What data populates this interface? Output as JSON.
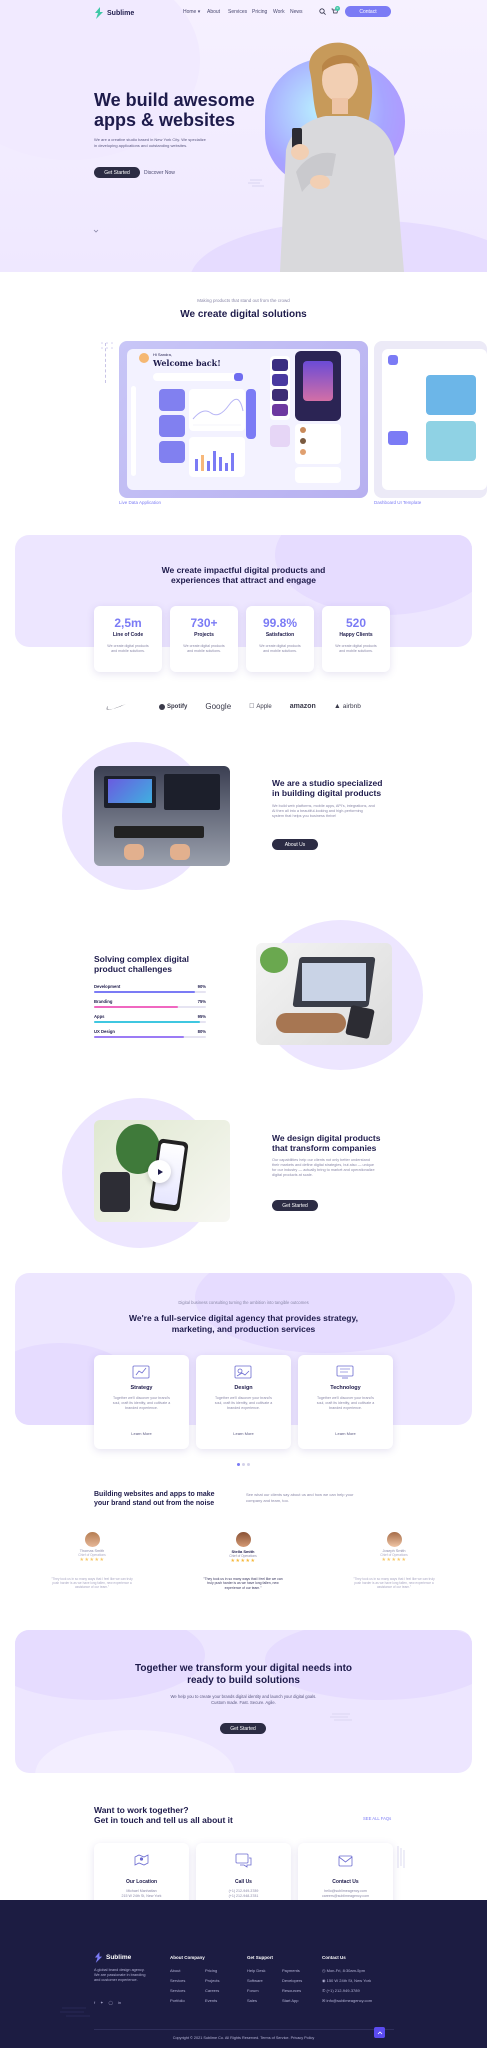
{
  "nav": {
    "brand": "Sublime",
    "links": [
      "Home ▾",
      "About",
      "Services",
      "Pricing",
      "Work",
      "News"
    ],
    "cart_count": "0",
    "contact_button": "Contact"
  },
  "hero": {
    "title_line1": "We build awesome",
    "title_line2": "apps & websites",
    "description_line1": "We are a creative studio based in New York City. We specialize",
    "description_line2": "in developing applications and outstanding websites.",
    "cta_primary": "Get Started",
    "cta_secondary": "Discover Now"
  },
  "showcase": {
    "overline": "Making products that stand out from the crowd",
    "title": "We create digital solutions",
    "mockup_greeting": "Hi Sandra,",
    "mockup_title": "Welcome back!",
    "captions": [
      "Live Data Application",
      "Dashboard UI Template"
    ]
  },
  "stats": {
    "title_line1": "We create impactful digital products and",
    "title_line2": "experiences that attract and engage",
    "items": [
      {
        "value": "2,5m",
        "label": "Line of Code",
        "text1": "We create digital products",
        "text2": "and mobile solutions."
      },
      {
        "value": "730+",
        "label": "Projects",
        "text1": "We create digital products",
        "text2": "and mobile solutions."
      },
      {
        "value": "99.8%",
        "label": "Satisfaction",
        "text1": "We create digital products",
        "text2": "and mobile solutions."
      },
      {
        "value": "520",
        "label": "Happy Clients",
        "text1": "We create digital products",
        "text2": "and mobile solutions."
      }
    ]
  },
  "logos": [
    "nike",
    "Spotify",
    "Google",
    "Apple",
    "amazon",
    "airbnb"
  ],
  "studio": {
    "title_line1": "We are a studio specialized",
    "title_line2": "in building digital products",
    "text": [
      "We build web platforms, mobile apps, API's, integrations, and",
      "Ai then all into a beautiful-looking and high-performing",
      "system that helps you business thrive!"
    ],
    "button": "About Us"
  },
  "skills": {
    "title_line1": "Solving complex digital",
    "title_line2": "product challenges",
    "items": [
      {
        "label": "Development",
        "value": "90%",
        "fraction": 0.9
      },
      {
        "label": "Branding",
        "value": "75%",
        "fraction": 0.75
      },
      {
        "label": "Apps",
        "value": "95%",
        "fraction": 0.95
      },
      {
        "label": "UX Design",
        "value": "80%",
        "fraction": 0.8
      }
    ]
  },
  "transform": {
    "title_line1": "We design digital products",
    "title_line2": "that transform companies",
    "text": [
      "Our capabilities help our clients not only better understand",
      "their markets and define digital strategies, but also — unique",
      "for our industry — actually bring to market and operationalize",
      "digital products at scale."
    ],
    "button": "Get Started"
  },
  "services": {
    "overline": "Digital business consulting turning the ambition into tangible outcomes",
    "title_line1": "We're a full-service digital agency that provides strategy,",
    "title_line2": "marketing, and production services",
    "items": [
      {
        "title": "Strategy",
        "text": [
          "Together we'll discover your brand's",
          "soul, craft its identity, and cultivate a",
          "branded experience."
        ],
        "link": "Learn More"
      },
      {
        "title": "Design",
        "text": [
          "Together we'll discover your brand's",
          "soul, craft its identity, and cultivate a",
          "branded experience."
        ],
        "link": "Learn More"
      },
      {
        "title": "Technology",
        "text": [
          "Together we'll discover your brand's",
          "soul, craft its identity, and cultivate a",
          "branded experience."
        ],
        "link": "Learn More"
      }
    ]
  },
  "testimonials": {
    "title_line1": "Building websites  and apps to make",
    "title_line2": "your brand stand out from the noise",
    "intro_line1": "See what our clients say about us and how we can help your",
    "intro_line2": "company and team, too.",
    "items": [
      {
        "name": "Thomas Smith",
        "role": "Chief of Operations",
        "stars": 5,
        "quote": [
          "\"They took us in so many ways that I feel like we can truly",
          "push harder is as we have long fallen, new experience a",
          "assistance of our team.\""
        ]
      },
      {
        "name": "Stella Smith",
        "role": "Chief of Operations",
        "stars": 5,
        "quote": [
          "\"They took us in so many ways that I feel like we can",
          "truly push harder is as we have long fallen, new",
          "experience of our team.\""
        ]
      },
      {
        "name": "Joseph Smith",
        "role": "Chief of Operations",
        "stars": 5,
        "quote": [
          "\"They took us in so many ways that I feel like we can truly",
          "push harder is as we have long fallen, new experience a",
          "assistance of our team.\""
        ]
      }
    ]
  },
  "cta": {
    "title_line1": "Together we transform your digital needs into",
    "title_line2": "ready to build solutions",
    "text_line1": "We help you to create your brands digital identity and launch your digital goals.",
    "text_line2": "Custom made. Fast. Secure. Agile.",
    "button": "Get Started"
  },
  "contact": {
    "title_line1": "Want to work together?",
    "title_line2": "Get in touch and tell us all about it",
    "link": "SEE ALL FAQs",
    "cards": [
      {
        "title": "Our Location",
        "lines": [
          "Michael Manhattan",
          "215 W 24th St, New York"
        ]
      },
      {
        "title": "Call Us",
        "lines": [
          "(+1) 212-949-3789",
          "(+1) 212-948-3781"
        ]
      },
      {
        "title": "Contact Us",
        "lines": [
          "hello@sublimeagency.com",
          "careers@sublimeagency.com"
        ]
      }
    ]
  },
  "footer": {
    "brand": "Sublime",
    "about_text": [
      "A global brand design agency.",
      "We are passionate in branding",
      "and customer experience."
    ],
    "columns": [
      {
        "title": "About Company",
        "links": [
          "About",
          "Services",
          "Services",
          "Portfolio"
        ]
      },
      {
        "title": "",
        "links": [
          "Pricing",
          "Projects",
          "Careers",
          "Events"
        ]
      },
      {
        "title": "Get Support",
        "links": [
          "Help Desk",
          "Software",
          "Forum",
          "Sales"
        ]
      },
      {
        "title": "",
        "links": [
          "Payments",
          "Developers",
          "Resources",
          "Start App"
        ]
      },
      {
        "title": "Contact Us",
        "links": [
          "Mon-Fri, 8:30am-5pm",
          "150 W 24th St, New York",
          "(+1) 212-949-3789",
          "info@sublimeagency.com"
        ]
      }
    ],
    "copyright": "Copyright © 2021 Sublime Co. All Rights Reserved. Terms of Service. Privacy Policy"
  },
  "colors": {
    "accent": "#7b7bf5",
    "navy": "#1e1b4b",
    "lavender": "#ece3ff",
    "footer": "#1c1c42"
  }
}
